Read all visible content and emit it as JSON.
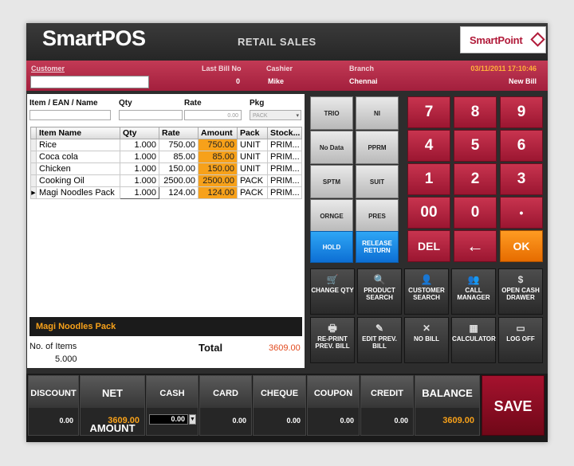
{
  "header": {
    "brand": "SmartPOS",
    "module": "RETAIL SALES",
    "logo_text": "SmartPoint"
  },
  "info": {
    "customer_label": "Customer",
    "last_bill_label": "Last Bill No",
    "last_bill_value": "0",
    "cashier_label": "Cashier",
    "cashier_value": "Mike",
    "branch_label": "Branch",
    "branch_value": "Chennai",
    "datetime": "03/11/2011 17:10:46",
    "bill_status": "New Bill"
  },
  "entry": {
    "item_label": "Item / EAN / Name",
    "qty_label": "Qty",
    "rate_label": "Rate",
    "pkg_label": "Pkg",
    "rate_value": "0.00",
    "pkg_value": "PACK"
  },
  "grid": {
    "columns": [
      "Item Name",
      "Qty",
      "Rate",
      "Amount",
      "Pack",
      "Stock..."
    ],
    "rows": [
      {
        "name": "Rice",
        "qty": "1.000",
        "rate": "750.00",
        "amount": "750.00",
        "pack": "UNIT",
        "stock": "PRIM..."
      },
      {
        "name": "Coca cola",
        "qty": "1.000",
        "rate": "85.00",
        "amount": "85.00",
        "pack": "UNIT",
        "stock": "PRIM..."
      },
      {
        "name": "Chicken",
        "qty": "1.000",
        "rate": "150.00",
        "amount": "150.00",
        "pack": "UNIT",
        "stock": "PRIM..."
      },
      {
        "name": "Cooking Oil",
        "qty": "1.000",
        "rate": "2500.00",
        "amount": "2500.00",
        "pack": "PACK",
        "stock": "PRIM..."
      },
      {
        "name": "Magi Noodles Pack",
        "qty": "1.000",
        "rate": "124.00",
        "amount": "124.00",
        "pack": "PACK",
        "stock": "PRIM..."
      }
    ]
  },
  "selected_item": "Magi Noodles Pack",
  "summary": {
    "items_label": "No. of Items",
    "items_value": "5.000",
    "total_label": "Total",
    "total_value": "3609.00"
  },
  "category_buttons": [
    "TRIO",
    "NI",
    "No Data",
    "PPRM",
    "SPTM",
    "SUIT",
    "ORNGE",
    "PRES"
  ],
  "hold_label": "HOLD",
  "release_label": "RELEASE RETURN",
  "numpad": [
    "7",
    "8",
    "9",
    "4",
    "5",
    "6",
    "1",
    "2",
    "3",
    "00",
    "0",
    "•",
    "DEL",
    "←",
    "OK"
  ],
  "functions": [
    {
      "label": "CHANGE QTY",
      "icon": "cart-icon"
    },
    {
      "label": "PRODUCT SEARCH",
      "icon": "globe-search-icon"
    },
    {
      "label": "CUSTOMER SEARCH",
      "icon": "person-search-icon"
    },
    {
      "label": "CALL MANAGER",
      "icon": "people-icon"
    },
    {
      "label": "OPEN CASH DRAWER",
      "icon": "dollar-icon"
    },
    {
      "label": "RE-PRINT PREV. BILL",
      "icon": "printer-icon"
    },
    {
      "label": "EDIT PREV. BILL",
      "icon": "edit-icon"
    },
    {
      "label": "NO BILL",
      "icon": "cancel-print-icon"
    },
    {
      "label": "CALCULATOR",
      "icon": "calculator-icon"
    },
    {
      "label": "LOG OFF",
      "icon": "monitor-icon"
    }
  ],
  "bottom": {
    "discount_label": "DISCOUNT",
    "discount_value": "0.00",
    "net_label": "NET AMOUNT",
    "net_value": "3609.00",
    "cash_label": "CASH",
    "cash_value": "0.00",
    "card_label": "CARD",
    "card_value": "0.00",
    "cheque_label": "CHEQUE",
    "cheque_value": "0.00",
    "coupon_label": "COUPON",
    "coupon_value": "0.00",
    "credit_label": "CREDIT",
    "credit_value": "0.00",
    "balance_label": "BALANCE",
    "balance_value": "3609.00",
    "save_label": "SAVE"
  }
}
